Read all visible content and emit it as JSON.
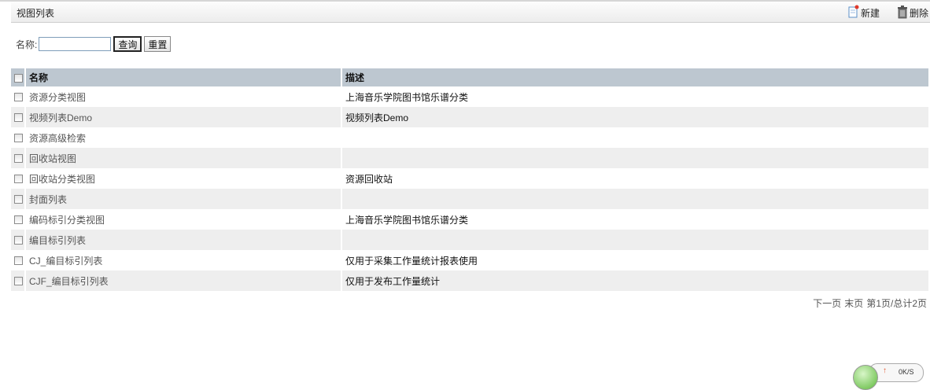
{
  "header": {
    "title": "视图列表",
    "new_label": "新建",
    "delete_label": "删除"
  },
  "search": {
    "label": "名称:",
    "value": "",
    "query_label": "查询",
    "reset_label": "重置"
  },
  "table": {
    "columns": [
      "名称",
      "描述"
    ],
    "rows": [
      {
        "name": "资源分类视图",
        "desc": "上海音乐学院图书馆乐谱分类"
      },
      {
        "name": "视频列表Demo",
        "desc": "视频列表Demo"
      },
      {
        "name": "资源高级检索",
        "desc": ""
      },
      {
        "name": "回收站视图",
        "desc": ""
      },
      {
        "name": "回收站分类视图",
        "desc": "资源回收站"
      },
      {
        "name": "封面列表",
        "desc": ""
      },
      {
        "name": "编码标引分类视图",
        "desc": "上海音乐学院图书馆乐谱分类"
      },
      {
        "name": "编目标引列表",
        "desc": ""
      },
      {
        "name": "CJ_编目标引列表",
        "desc": "仅用于采集工作量统计报表使用"
      },
      {
        "name": "CJF_编目标引列表",
        "desc": "仅用于发布工作量统计"
      }
    ]
  },
  "pager": {
    "next": "下一页",
    "last": "末页",
    "status": "第1页/总计2页"
  },
  "speed_widget": {
    "value": "0K/S"
  },
  "icons": {
    "new": "new-document-icon",
    "delete": "trash-icon"
  }
}
